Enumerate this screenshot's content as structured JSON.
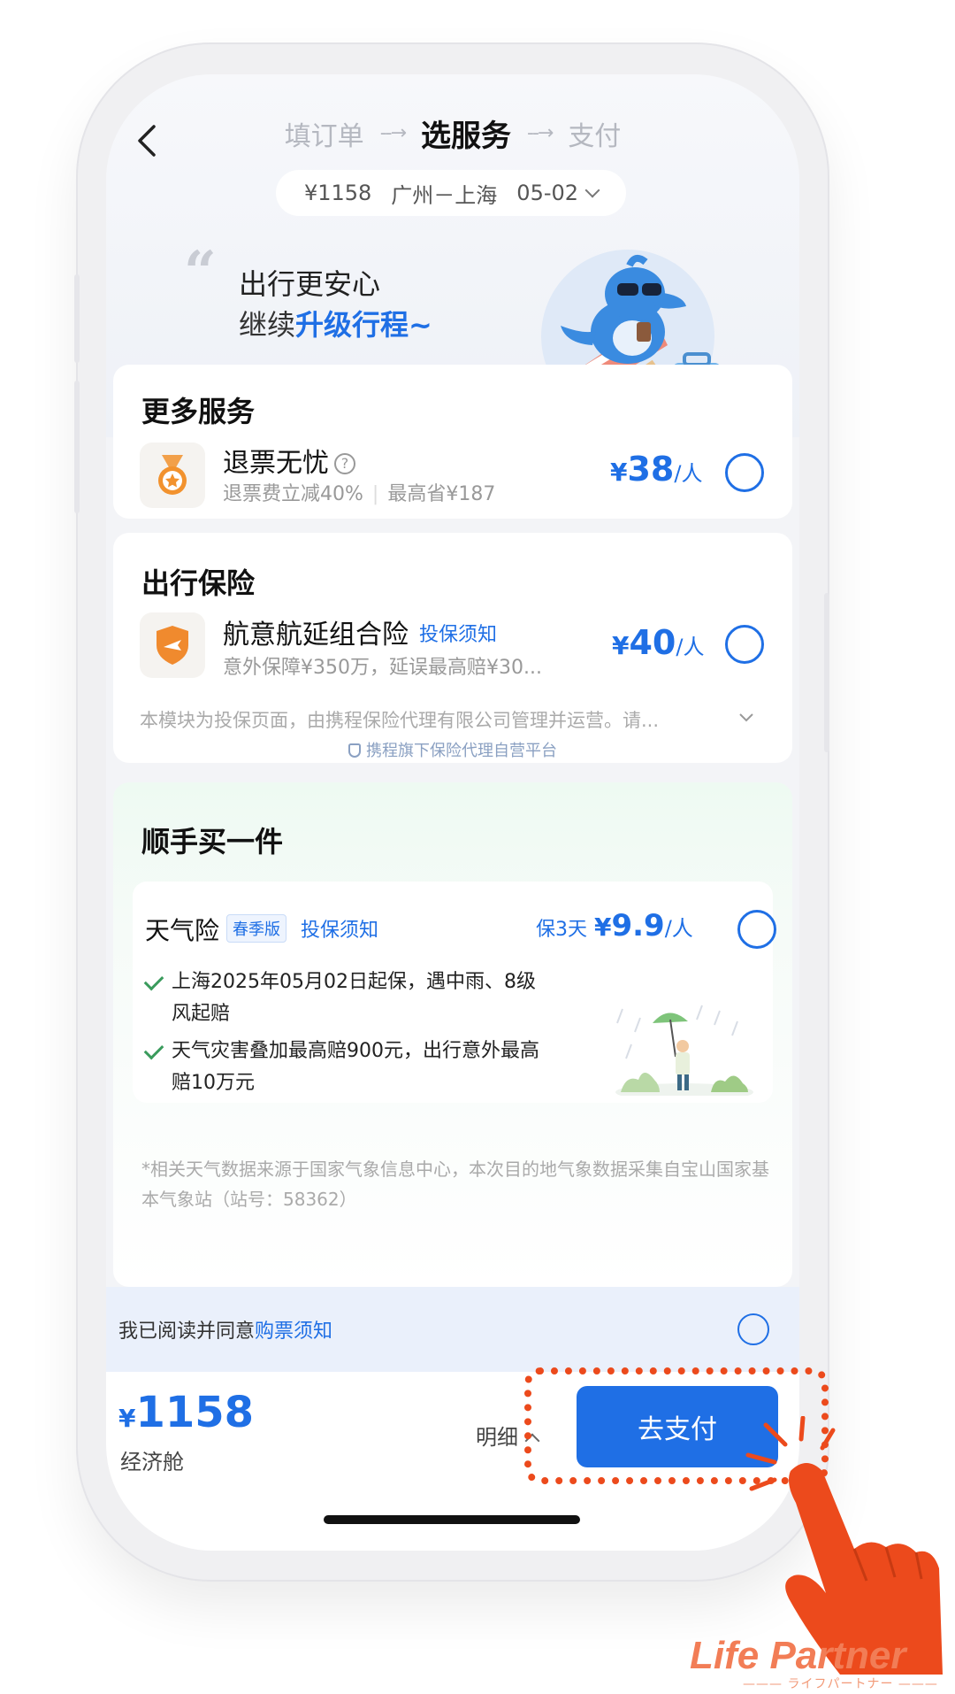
{
  "nav": {
    "steps": [
      "填订单",
      "选服务",
      "支付"
    ],
    "active_step": 1,
    "arrow": "--→"
  },
  "flight": {
    "price": "¥1158",
    "route": "广州－上海",
    "date": "05-02"
  },
  "promo": {
    "line1": "出行更安心",
    "line2_prefix": "继续",
    "line2_highlight": "升级行程",
    "line2_suffix": "~"
  },
  "more_services": {
    "title": "更多服务",
    "item": {
      "name": "退票无忧",
      "help": "?",
      "sub1": "退票费立减40%",
      "sub2": "最高省¥187",
      "price_symbol": "¥",
      "price": "38",
      "unit": "/人"
    }
  },
  "insurance": {
    "title": "出行保险",
    "item": {
      "name": "航意航延组合险",
      "notice": "投保须知",
      "sub": "意外保障¥350万，延误最高赔¥30...",
      "price_symbol": "¥",
      "price": "40",
      "unit": "/人"
    },
    "disclaimer": "本模块为投保页面，由携程保险代理有限公司管理并运营。请...",
    "platform": "携程旗下保险代理自营平台"
  },
  "add_on": {
    "title": "顺手买一件",
    "item": {
      "name": "天气险",
      "badge": "春季版",
      "notice": "投保须知",
      "duration": "保3天",
      "price_symbol": "¥",
      "price": "9.9",
      "unit": "/人"
    },
    "bullets": [
      "上海2025年05月02日起保，遇中雨、8级风起赔",
      "天气灾害叠加最高赔900元，出行意外最高赔10万元"
    ],
    "note": "*相关天气数据来源于国家气象信息中心，本次目的地气象数据采集自宝山国家基本气象站（站号：58362）"
  },
  "agreement": {
    "text": "我已阅读并同意",
    "link": "购票须知"
  },
  "bottom": {
    "price_symbol": "¥",
    "price": "1158",
    "cabin": "经济舱",
    "detail": "明细",
    "pay": "去支付"
  },
  "watermark": {
    "main": "Life Partner",
    "sub": "——— ライフパートナー ———"
  },
  "colors": {
    "accent": "#1f6fe5",
    "highlight": "#ec4a1c",
    "check": "#3a9b5c"
  }
}
